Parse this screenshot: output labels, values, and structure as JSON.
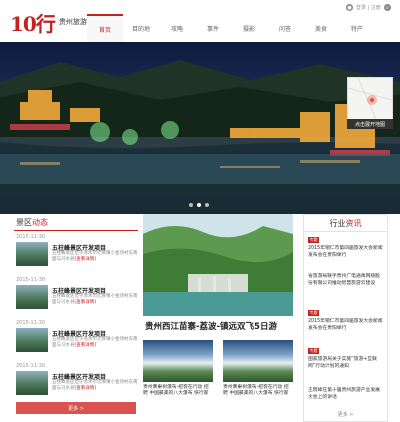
{
  "header": {
    "logo_mark": "10行",
    "logo_text": "贵州旅游大全",
    "nav": [
      "首页",
      "目的地",
      "攻略",
      "事件",
      "摄影",
      "问答",
      "美食",
      "特产"
    ],
    "active_nav": 0,
    "login_label": "登录 | 注册"
  },
  "hero": {
    "map_button": "点击展开地图",
    "slides": 3,
    "active_slide": 1
  },
  "left": {
    "title_prefix": "景区",
    "title_highlight": "动态",
    "news": [
      {
        "date": "2015-11-30",
        "title": "五柱峰景区开发项目",
        "desc": "五柱峰景区位于赤水市元厚镇小金顶村东南面与习水县",
        "more": "[查看详情]"
      },
      {
        "date": "2015-11-30",
        "title": "五柱峰景区开发项目",
        "desc": "五柱峰景区位于赤水市元厚镇小金顶村东南面与习水县",
        "more": "[查看详情]"
      },
      {
        "date": "2015-11-30",
        "title": "五柱峰景区开发项目",
        "desc": "五柱峰景区位于赤水市元厚镇小金顶村东南面与习水县",
        "more": "[查看详情]"
      },
      {
        "date": "2015-11-30",
        "title": "五柱峰景区开发项目",
        "desc": "五柱峰景区位于赤水市元厚镇小金顶村东南面与习水县",
        "more": "[查看详情]"
      }
    ],
    "more_button": "更多 >"
  },
  "middle": {
    "feature_title": "贵州西江苗寨-荔波-镇远双飞5日游",
    "cards": [
      {
        "text": "贵州黄果树瀑布-招客在行动 招聘 中国最美的八大瀑布 快行家"
      },
      {
        "text": "贵州黄果树瀑布-招客在行动 招聘 中国最美的八大瀑布 快行家"
      }
    ]
  },
  "right": {
    "title_prefix": "行业",
    "title_highlight": "资讯",
    "items": [
      {
        "badge": "专题",
        "text": "2015年铜仁市第四届旅发大会新闻发布会在贵阳举行"
      },
      {
        "badge": "",
        "text": "省旅游局联手贵州广电通禹网络股份有限公司推动智慧旅游云建设"
      },
      {
        "badge": "专题",
        "text": "2015年铜仁市第四届旅发大会新闻发布会在贵阳举行"
      },
      {
        "badge": "专题",
        "text": "国家旅游局关于实施“旅游+互联网”行动计划的通知"
      },
      {
        "badge": "",
        "text": "王晓峰在第十届贵州旅游产业发展大会上的讲话"
      }
    ],
    "more": "更多 >"
  },
  "colors": {
    "accent": "#c6211f",
    "button": "#d9534f"
  },
  "icons": [
    "user-icon",
    "search-icon",
    "map-pin-icon"
  ]
}
